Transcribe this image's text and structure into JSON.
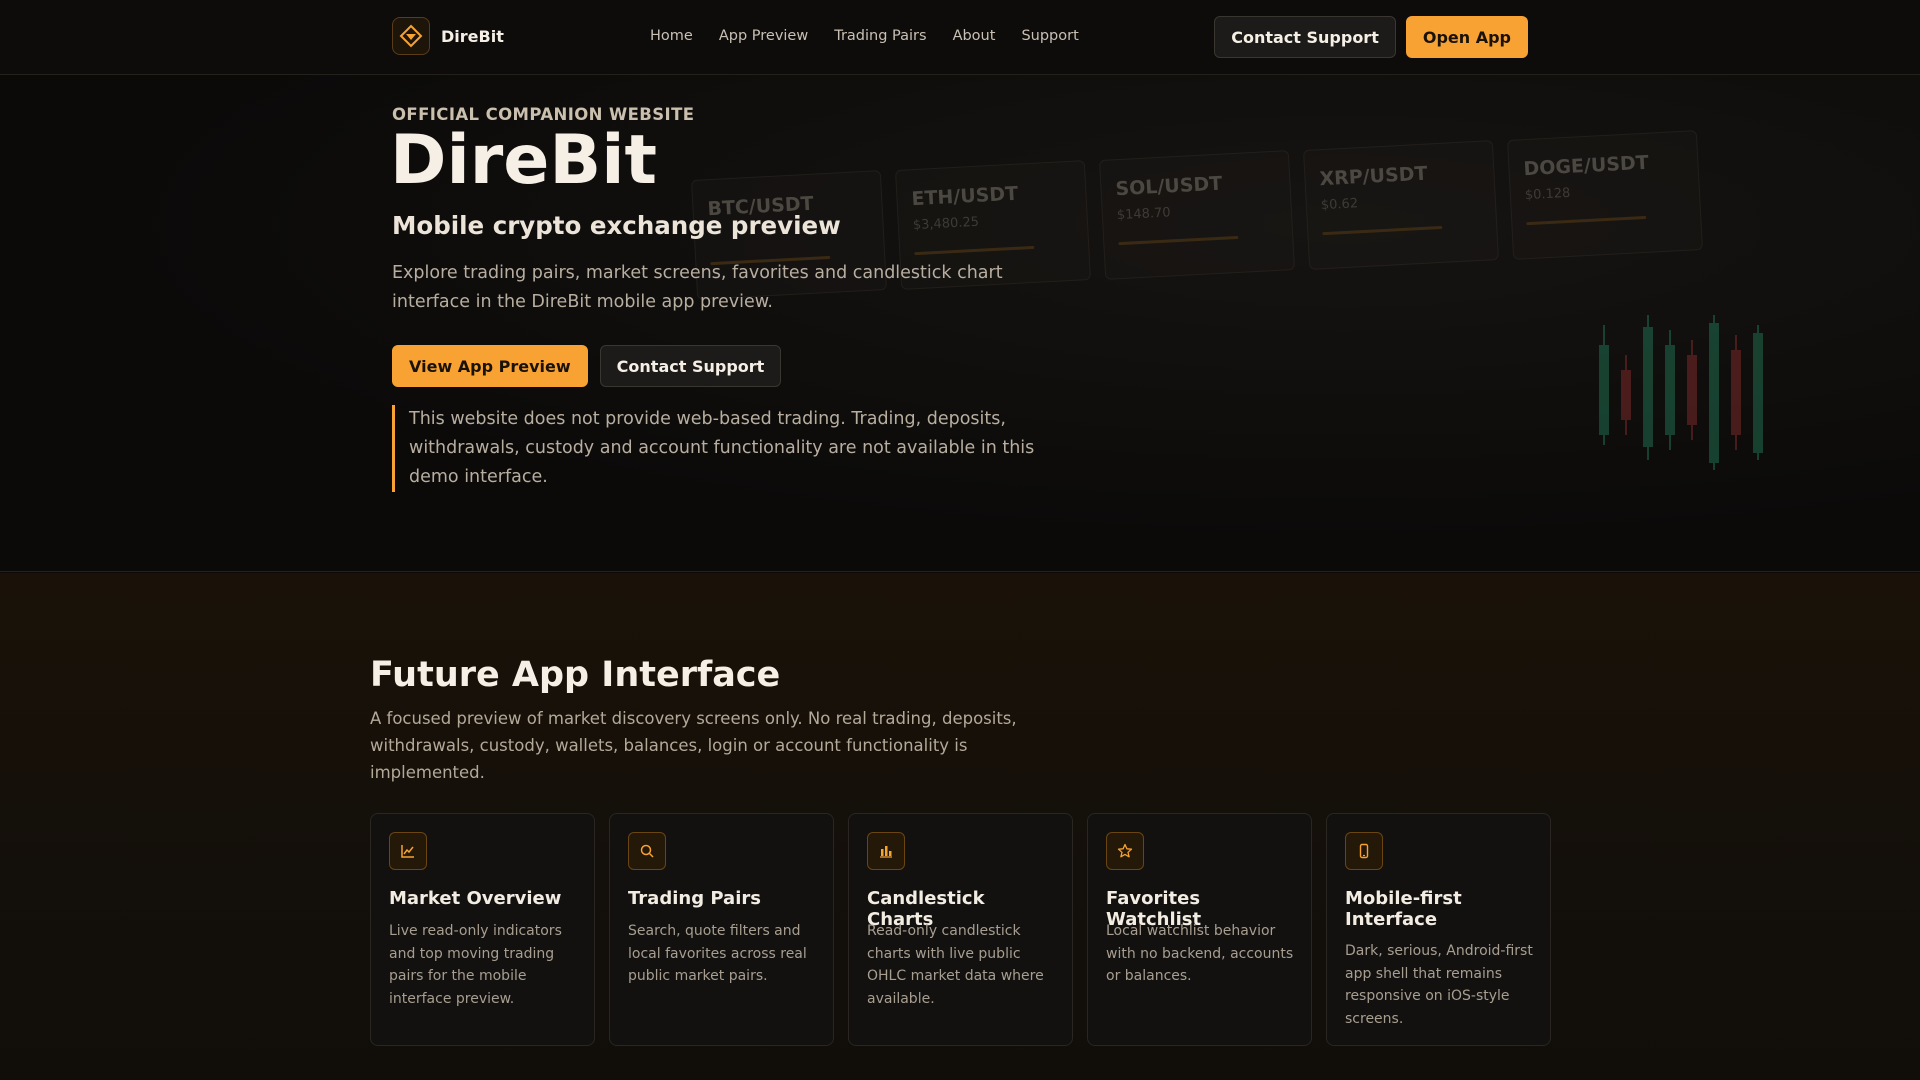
{
  "nav": {
    "brand_name": "DireBit",
    "links": [
      "Home",
      "App Preview",
      "Trading Pairs",
      "About",
      "Support"
    ],
    "contact_label": "Contact Support",
    "open_app_label": "Open App"
  },
  "hero": {
    "eyebrow": "OFFICIAL COMPANION WEBSITE",
    "title": "DireBit",
    "subtitle": "Mobile crypto exchange preview",
    "description": "Explore trading pairs, market screens, favorites and candlestick chart interface in the DireBit mobile app preview.",
    "primary_cta": "View App Preview",
    "secondary_cta": "Contact Support",
    "notice": "This website does not provide web-based trading. Trading, deposits, withdrawals, custody and account functionality are not available in this demo interface.",
    "pairs": [
      {
        "name": "BTC/USDT",
        "price": ""
      },
      {
        "name": "ETH/USDT",
        "price": "$3,480.25"
      },
      {
        "name": "SOL/USDT",
        "price": "$148.70"
      },
      {
        "name": "XRP/USDT",
        "price": "$0.62"
      },
      {
        "name": "DOGE/USDT",
        "price": "$0.128"
      }
    ]
  },
  "features": {
    "title": "Future App Interface",
    "description": "A focused preview of market discovery screens only. No real trading, deposits, withdrawals, custody, wallets, balances, login or account functionality is implemented.",
    "cards": [
      {
        "icon": "line-chart-icon",
        "title": "Market Overview",
        "text": "Live read-only indicators and top moving trading pairs for the mobile interface preview."
      },
      {
        "icon": "search-icon",
        "title": "Trading Pairs",
        "text": "Search, quote filters and local favorites across real public market pairs."
      },
      {
        "icon": "bar-chart-icon",
        "title": "Candlestick Charts",
        "text": "Read-only candlestick charts with live public OHLC market data where available."
      },
      {
        "icon": "star-icon",
        "title": "Favorites Watchlist",
        "text": "Local watchlist behavior with no backend, accounts or balances."
      },
      {
        "icon": "smartphone-icon",
        "title": "Mobile-first Interface",
        "text": "Dark, serious, Android-first app shell that remains responsive on iOS-style screens."
      }
    ]
  },
  "colors": {
    "accent": "#f7a233",
    "background": "#0b0a09",
    "candle_up": "#1f6b4e",
    "candle_down": "#7a2a2a"
  }
}
